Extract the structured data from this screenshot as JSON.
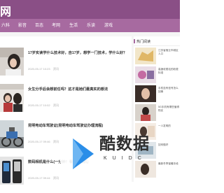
{
  "header": {
    "logo": "网"
  },
  "nav": [
    "六科",
    "影音",
    "百态",
    "考网",
    "生活",
    "乐读",
    "游戏"
  ],
  "articles": [
    {
      "title": "17岁实读学什么技术好，自17岁，想学一门技术，学什么好？",
      "excerpt": "",
      "date": "2020-05-17 10:23",
      "tag": "资讯"
    },
    {
      "title": "女生分手后会想前任吗？这才是她们最真实的想法",
      "excerpt": "",
      "date": "2020-05-17 10:02",
      "tag": "资讯"
    },
    {
      "title": "昆明电动车驾驶证(昆明电动车驾驶证办理流程)",
      "excerpt": "",
      "date": "2020-05-17 09:46",
      "tag": "资讯"
    },
    {
      "title": "数码相机是什么(一分钟！看数码相机)",
      "excerpt": "",
      "date": "2020-05-17 09:44",
      "tag": "资讯"
    }
  ],
  "sidebar": {
    "heading": "热门阅读",
    "items": [
      {
        "text": "江苏省宿迁市城区人口",
        "date": ""
      },
      {
        "text": "高速收费站的收费标准",
        "date": ""
      },
      {
        "text": "手机没有信号怎么回事",
        "date": ""
      },
      {
        "text": "5G手机有哪些值得购买",
        "date": ""
      },
      {
        "text": "一人发明的",
        "date": ""
      },
      {
        "text": "如何做好",
        "date": ""
      },
      {
        "text": "最新冬季保暖手段",
        "date": ""
      }
    ]
  },
  "watermark": {
    "text": "酷数据",
    "sub": "KUIDC"
  },
  "colors": {
    "header": "#8a4f86",
    "nav": "#a76aa0",
    "watermark_blue": "#2b8ee8"
  }
}
